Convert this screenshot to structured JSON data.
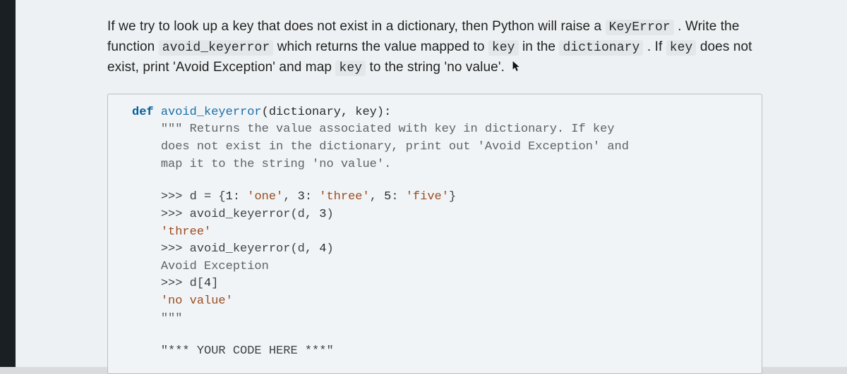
{
  "paragraph": {
    "t1": "If we try to look up a key that does not exist in a dictionary, then Python will raise a ",
    "c1": "KeyError",
    "t2": " . Write the function ",
    "c2": "avoid_keyerror",
    "t3": " which returns the value mapped to ",
    "c3": "key",
    "t4": " in the ",
    "c4": "dictionary",
    "t5": " . If ",
    "c5": "key",
    "t6": " does not exist, print 'Avoid Exception' and map ",
    "c6": "key",
    "t7": " to the string 'no value'."
  },
  "code": {
    "def_kw": "def",
    "func_name": "avoid_keyerror",
    "sig_tail": "(dictionary, key):",
    "doc_open": "\"\"\"",
    "doc_l1_tail": " Returns the value associated with key in dictionary. If key",
    "doc_l2": "does not exist in the dictionary, print out 'Avoid Exception' and",
    "doc_l3": "map it to the string 'no value'.",
    "ex1_prompt": ">>> ",
    "ex1_body_a": "d = {",
    "ex1_num1": "1",
    "ex1_colon": ": ",
    "ex1_str1": "'one'",
    "ex1_sep": ", ",
    "ex1_num2": "3",
    "ex1_str2": "'three'",
    "ex1_num3": "5",
    "ex1_str3": "'five'",
    "ex1_close": "}",
    "ex2_prompt": ">>> ",
    "ex2_body": "avoid_keyerror(d, ",
    "ex2_arg": "3",
    "ex2_close": ")",
    "ex2_out": "'three'",
    "ex3_prompt": ">>> ",
    "ex3_body": "avoid_keyerror(d, ",
    "ex3_arg": "4",
    "ex3_close": ")",
    "ex3_out": "Avoid Exception",
    "ex4_prompt": ">>> ",
    "ex4_body": "d[",
    "ex4_arg": "4",
    "ex4_close": "]",
    "ex4_out": "'no value'",
    "doc_close": "\"\"\"",
    "placeholder": "\"*** YOUR CODE HERE ***\""
  }
}
